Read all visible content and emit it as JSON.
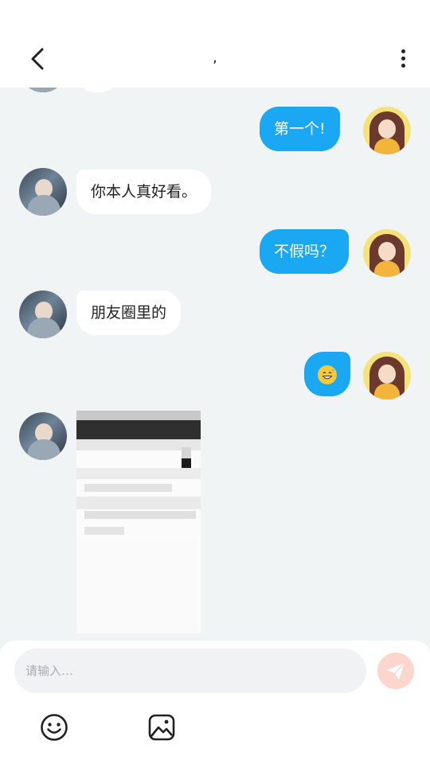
{
  "header": {
    "title": ",",
    "back_icon": "chevron-left-icon",
    "more_icon": "more-vertical-icon"
  },
  "messages": [
    {
      "sender": "me",
      "text": "第一个!"
    },
    {
      "sender": "other",
      "text": "你本人真好看。"
    },
    {
      "sender": "me",
      "text": "不假吗？"
    },
    {
      "sender": "other",
      "text": "朋友圈里的"
    },
    {
      "sender": "me",
      "emoji": "grinning-sweat-emoji"
    },
    {
      "sender": "other",
      "image": "shared-screenshot-blurred"
    }
  ],
  "composer": {
    "placeholder": "请输入…",
    "value": "",
    "send_icon": "paper-plane-icon",
    "emoji_icon": "smiley-icon",
    "picture_icon": "image-icon"
  },
  "colors": {
    "accent": "#1aa8f2",
    "background": "#f1f4f5",
    "send_button": "#fcd6cc"
  }
}
